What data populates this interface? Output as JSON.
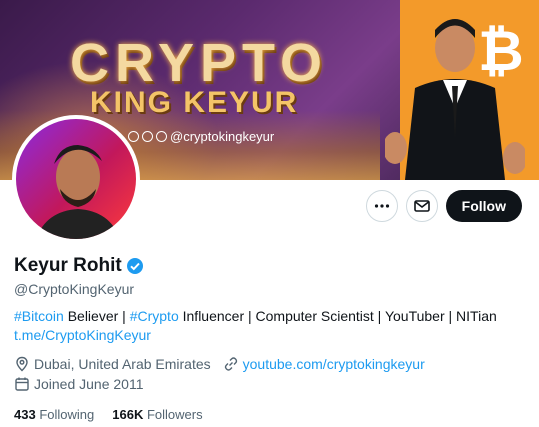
{
  "banner": {
    "title_line1": "CRYPTO",
    "title_line2": "KING KEYUR",
    "social_handle": "@cryptokingkeyur",
    "btc_symbol": "₿"
  },
  "actions": {
    "more_icon": "ellipsis-icon",
    "message_icon": "mail-icon",
    "follow_label": "Follow"
  },
  "profile": {
    "name": "Keyur Rohit",
    "verified": true,
    "handle": "@CryptoKingKeyur",
    "bio": {
      "hashtag1": "#Bitcoin",
      "text1": " Believer | ",
      "hashtag2": "#Crypto",
      "text2": " Influencer | Computer Scientist | YouTuber | NITian",
      "link": "t.me/CryptoKingKeyur"
    },
    "location": "Dubai, United Arab Emirates",
    "website": "youtube.com/cryptokingkeyur",
    "joined": "Joined June 2011",
    "following_count": "433",
    "following_label": "Following",
    "followers_count": "166K",
    "followers_label": "Followers"
  },
  "colors": {
    "accent": "#1d9bf0",
    "text": "#0f1419",
    "muted": "#536471"
  }
}
